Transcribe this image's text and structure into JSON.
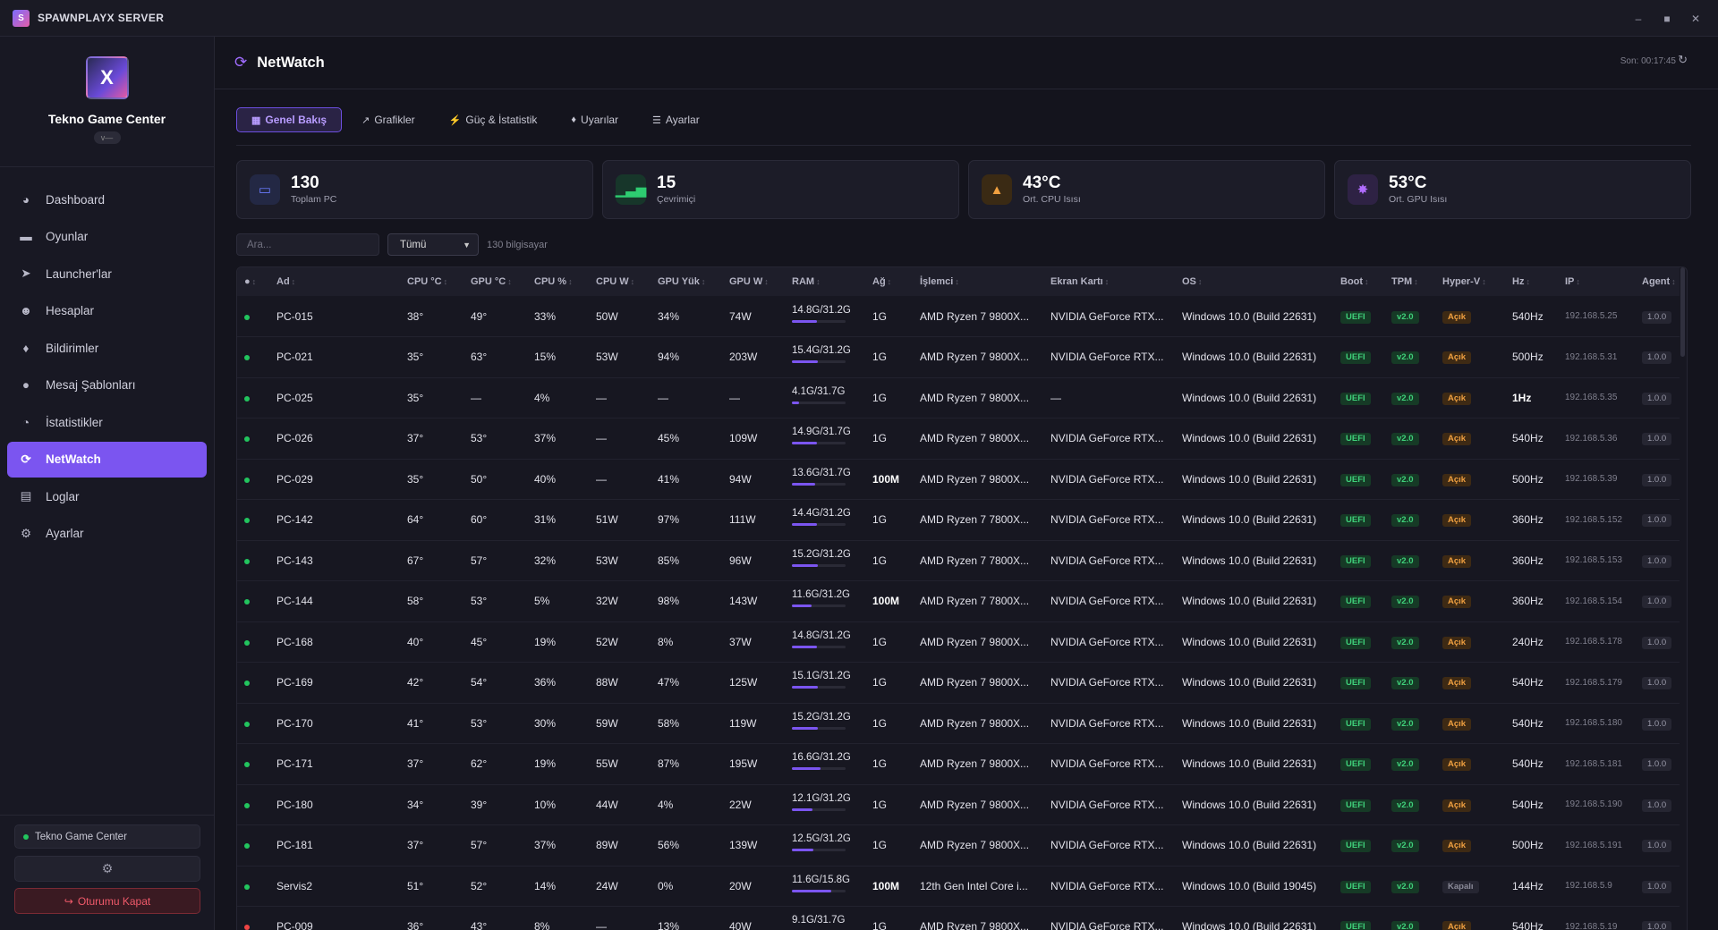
{
  "app": {
    "title": "SPAWNPLAYX SERVER",
    "icon_letter": "S"
  },
  "sidebar": {
    "logo_text": "X",
    "org_name": "Tekno Game Center",
    "org_badge": "v—",
    "items": [
      {
        "label": "Dashboard",
        "icon": "dashboard-icon"
      },
      {
        "label": "Oyunlar",
        "icon": "gamepad-icon"
      },
      {
        "label": "Launcher'lar",
        "icon": "rocket-icon"
      },
      {
        "label": "Hesaplar",
        "icon": "users-icon"
      },
      {
        "label": "Bildirimler",
        "icon": "bell-icon"
      },
      {
        "label": "Mesaj Şablonları",
        "icon": "comments-icon"
      },
      {
        "label": "İstatistikler",
        "icon": "pie-chart-icon"
      },
      {
        "label": "NetWatch",
        "icon": "netwatch-icon",
        "active": true
      },
      {
        "label": "Loglar",
        "icon": "clipboard-icon"
      },
      {
        "label": "Ayarlar",
        "icon": "gear-icon"
      }
    ],
    "center_name": "Tekno Game Center",
    "logout_label": "Oturumu Kapat"
  },
  "header": {
    "title": "NetWatch",
    "last_update": "Son: 00:17:45"
  },
  "tabs": [
    {
      "label": "Genel Bakış",
      "icon": "table-icon",
      "active": true
    },
    {
      "label": "Grafikler",
      "icon": "chart-icon"
    },
    {
      "label": "Güç & İstatistik",
      "icon": "bolt-icon"
    },
    {
      "label": "Uyarılar",
      "icon": "bell-icon"
    },
    {
      "label": "Ayarlar",
      "icon": "sliders-icon"
    }
  ],
  "stats": [
    {
      "value": "130",
      "label": "Toplam PC",
      "icon": "monitor-icon",
      "color": "#6a7cff",
      "bg": "#232844"
    },
    {
      "value": "15",
      "label": "Çevrimiçi",
      "icon": "signal-icon",
      "color": "#2ecc71",
      "bg": "#17362a"
    },
    {
      "value": "43°C",
      "label": "Ort. CPU Isısı",
      "icon": "thermometer-icon",
      "color": "#f0a040",
      "bg": "#3a2a14"
    },
    {
      "value": "53°C",
      "label": "Ort. GPU Isısı",
      "icon": "gpu-icon",
      "color": "#b06cff",
      "bg": "#2e2244"
    }
  ],
  "filters": {
    "search_placeholder": "Ara...",
    "select_value": "Tümü",
    "count_label": "130 bilgisayar"
  },
  "table": {
    "columns": [
      "●",
      "Ad",
      "CPU °C",
      "GPU °C",
      "CPU %",
      "CPU W",
      "GPU Yük",
      "GPU W",
      "RAM",
      "Ağ",
      "İşlemci",
      "Ekran Kartı",
      "OS",
      "Boot",
      "TPM",
      "Hyper-V",
      "Hz",
      "IP",
      "Agent"
    ],
    "rows": [
      {
        "status": "online",
        "name": "PC-015",
        "cpu_t": "38°",
        "gpu_t": "49°",
        "cpu_p": "33%",
        "cpu_w": "50W",
        "gpu_l": "34%",
        "gpu_w": "74W",
        "ram": "14.8G/31.2G",
        "ram_frac": 0.47,
        "net": "1G",
        "cpu": "AMD Ryzen 7 9800X...",
        "gpu": "NVIDIA GeForce RTX...",
        "os": "Windows 10.0 (Build 22631)",
        "boot": "UEFI",
        "tpm": "v2.0",
        "hv": "Açık",
        "hz": "540Hz",
        "ip": "192.168.5.25",
        "agent": "1.0.0"
      },
      {
        "status": "online",
        "name": "PC-021",
        "cpu_t": "35°",
        "gpu_t": "63°",
        "cpu_p": "15%",
        "cpu_w": "53W",
        "gpu_l": "94%",
        "gpu_w": "203W",
        "ram": "15.4G/31.2G",
        "ram_frac": 0.49,
        "net": "1G",
        "cpu": "AMD Ryzen 7 9800X...",
        "gpu": "NVIDIA GeForce RTX...",
        "os": "Windows 10.0 (Build 22631)",
        "boot": "UEFI",
        "tpm": "v2.0",
        "hv": "Açık",
        "hz": "500Hz",
        "ip": "192.168.5.31",
        "agent": "1.0.0"
      },
      {
        "status": "online",
        "name": "PC-025",
        "cpu_t": "35°",
        "gpu_t": "—",
        "cpu_p": "4%",
        "cpu_w": "—",
        "gpu_l": "—",
        "gpu_w": "—",
        "ram": "4.1G/31.7G",
        "ram_frac": 0.13,
        "net": "1G",
        "cpu": "AMD Ryzen 7 9800X...",
        "gpu": "—",
        "os": "Windows 10.0 (Build 22631)",
        "boot": "UEFI",
        "tpm": "v2.0",
        "hv": "Açık",
        "hz": "1Hz",
        "hz_bold": true,
        "ip": "192.168.5.35",
        "agent": "1.0.0"
      },
      {
        "status": "online",
        "name": "PC-026",
        "cpu_t": "37°",
        "gpu_t": "53°",
        "cpu_p": "37%",
        "cpu_w": "—",
        "gpu_l": "45%",
        "gpu_w": "109W",
        "ram": "14.9G/31.7G",
        "ram_frac": 0.47,
        "net": "1G",
        "cpu": "AMD Ryzen 7 9800X...",
        "gpu": "NVIDIA GeForce RTX...",
        "os": "Windows 10.0 (Build 22631)",
        "boot": "UEFI",
        "tpm": "v2.0",
        "hv": "Açık",
        "hz": "540Hz",
        "ip": "192.168.5.36",
        "agent": "1.0.0"
      },
      {
        "status": "online",
        "name": "PC-029",
        "cpu_t": "35°",
        "gpu_t": "50°",
        "cpu_p": "40%",
        "cpu_w": "—",
        "gpu_l": "41%",
        "gpu_w": "94W",
        "ram": "13.6G/31.7G",
        "ram_frac": 0.43,
        "net": "100M",
        "net_bold": true,
        "cpu": "AMD Ryzen 7 9800X...",
        "gpu": "NVIDIA GeForce RTX...",
        "os": "Windows 10.0 (Build 22631)",
        "boot": "UEFI",
        "tpm": "v2.0",
        "hv": "Açık",
        "hz": "500Hz",
        "ip": "192.168.5.39",
        "agent": "1.0.0"
      },
      {
        "status": "online",
        "name": "PC-142",
        "cpu_t": "64°",
        "gpu_t": "60°",
        "cpu_p": "31%",
        "cpu_w": "51W",
        "gpu_l": "97%",
        "gpu_w": "111W",
        "ram": "14.4G/31.2G",
        "ram_frac": 0.46,
        "net": "1G",
        "cpu": "AMD Ryzen 7 7800X...",
        "gpu": "NVIDIA GeForce RTX...",
        "os": "Windows 10.0 (Build 22631)",
        "boot": "UEFI",
        "tpm": "v2.0",
        "hv": "Açık",
        "hz": "360Hz",
        "ip": "192.168.5.152",
        "agent": "1.0.0"
      },
      {
        "status": "online",
        "name": "PC-143",
        "cpu_t": "67°",
        "gpu_t": "57°",
        "cpu_p": "32%",
        "cpu_w": "53W",
        "gpu_l": "85%",
        "gpu_w": "96W",
        "ram": "15.2G/31.2G",
        "ram_frac": 0.49,
        "net": "1G",
        "cpu": "AMD Ryzen 7 7800X...",
        "gpu": "NVIDIA GeForce RTX...",
        "os": "Windows 10.0 (Build 22631)",
        "boot": "UEFI",
        "tpm": "v2.0",
        "hv": "Açık",
        "hz": "360Hz",
        "ip": "192.168.5.153",
        "agent": "1.0.0"
      },
      {
        "status": "online",
        "name": "PC-144",
        "cpu_t": "58°",
        "gpu_t": "53°",
        "cpu_p": "5%",
        "cpu_w": "32W",
        "gpu_l": "98%",
        "gpu_w": "143W",
        "ram": "11.6G/31.2G",
        "ram_frac": 0.37,
        "net": "100M",
        "net_bold": true,
        "cpu": "AMD Ryzen 7 7800X...",
        "gpu": "NVIDIA GeForce RTX...",
        "os": "Windows 10.0 (Build 22631)",
        "boot": "UEFI",
        "tpm": "v2.0",
        "hv": "Açık",
        "hz": "360Hz",
        "ip": "192.168.5.154",
        "agent": "1.0.0"
      },
      {
        "status": "online",
        "name": "PC-168",
        "cpu_t": "40°",
        "gpu_t": "45°",
        "cpu_p": "19%",
        "cpu_w": "52W",
        "gpu_l": "8%",
        "gpu_w": "37W",
        "ram": "14.8G/31.2G",
        "ram_frac": 0.47,
        "net": "1G",
        "cpu": "AMD Ryzen 7 9800X...",
        "gpu": "NVIDIA GeForce RTX...",
        "os": "Windows 10.0 (Build 22631)",
        "boot": "UEFI",
        "tpm": "v2.0",
        "hv": "Açık",
        "hz": "240Hz",
        "ip": "192.168.5.178",
        "agent": "1.0.0"
      },
      {
        "status": "online",
        "name": "PC-169",
        "cpu_t": "42°",
        "gpu_t": "54°",
        "cpu_p": "36%",
        "cpu_w": "88W",
        "gpu_l": "47%",
        "gpu_w": "125W",
        "ram": "15.1G/31.2G",
        "ram_frac": 0.48,
        "net": "1G",
        "cpu": "AMD Ryzen 7 9800X...",
        "gpu": "NVIDIA GeForce RTX...",
        "os": "Windows 10.0 (Build 22631)",
        "boot": "UEFI",
        "tpm": "v2.0",
        "hv": "Açık",
        "hz": "540Hz",
        "ip": "192.168.5.179",
        "agent": "1.0.0"
      },
      {
        "status": "online",
        "name": "PC-170",
        "cpu_t": "41°",
        "gpu_t": "53°",
        "cpu_p": "30%",
        "cpu_w": "59W",
        "gpu_l": "58%",
        "gpu_w": "119W",
        "ram": "15.2G/31.2G",
        "ram_frac": 0.49,
        "net": "1G",
        "cpu": "AMD Ryzen 7 9800X...",
        "gpu": "NVIDIA GeForce RTX...",
        "os": "Windows 10.0 (Build 22631)",
        "boot": "UEFI",
        "tpm": "v2.0",
        "hv": "Açık",
        "hz": "540Hz",
        "ip": "192.168.5.180",
        "agent": "1.0.0"
      },
      {
        "status": "online",
        "name": "PC-171",
        "cpu_t": "37°",
        "gpu_t": "62°",
        "cpu_p": "19%",
        "cpu_w": "55W",
        "gpu_l": "87%",
        "gpu_w": "195W",
        "ram": "16.6G/31.2G",
        "ram_frac": 0.53,
        "net": "1G",
        "cpu": "AMD Ryzen 7 9800X...",
        "gpu": "NVIDIA GeForce RTX...",
        "os": "Windows 10.0 (Build 22631)",
        "boot": "UEFI",
        "tpm": "v2.0",
        "hv": "Açık",
        "hz": "540Hz",
        "ip": "192.168.5.181",
        "agent": "1.0.0"
      },
      {
        "status": "online",
        "name": "PC-180",
        "cpu_t": "34°",
        "gpu_t": "39°",
        "cpu_p": "10%",
        "cpu_w": "44W",
        "gpu_l": "4%",
        "gpu_w": "22W",
        "ram": "12.1G/31.2G",
        "ram_frac": 0.39,
        "net": "1G",
        "cpu": "AMD Ryzen 7 9800X...",
        "gpu": "NVIDIA GeForce RTX...",
        "os": "Windows 10.0 (Build 22631)",
        "boot": "UEFI",
        "tpm": "v2.0",
        "hv": "Açık",
        "hz": "540Hz",
        "ip": "192.168.5.190",
        "agent": "1.0.0"
      },
      {
        "status": "online",
        "name": "PC-181",
        "cpu_t": "37°",
        "gpu_t": "57°",
        "cpu_p": "37%",
        "cpu_w": "89W",
        "gpu_l": "56%",
        "gpu_w": "139W",
        "ram": "12.5G/31.2G",
        "ram_frac": 0.4,
        "net": "1G",
        "cpu": "AMD Ryzen 7 9800X...",
        "gpu": "NVIDIA GeForce RTX...",
        "os": "Windows 10.0 (Build 22631)",
        "boot": "UEFI",
        "tpm": "v2.0",
        "hv": "Açık",
        "hz": "500Hz",
        "ip": "192.168.5.191",
        "agent": "1.0.0"
      },
      {
        "status": "online",
        "name": "Servis2",
        "cpu_t": "51°",
        "gpu_t": "52°",
        "cpu_p": "14%",
        "cpu_w": "24W",
        "gpu_l": "0%",
        "gpu_w": "20W",
        "ram": "11.6G/15.8G",
        "ram_frac": 0.73,
        "net": "100M",
        "net_bold": true,
        "cpu": "12th Gen Intel Core i...",
        "gpu": "NVIDIA GeForce RTX...",
        "os": "Windows 10.0 (Build 19045)",
        "boot": "UEFI",
        "tpm": "v2.0",
        "hv": "Kapalı",
        "hz": "144Hz",
        "ip": "192.168.5.9",
        "agent": "1.0.0"
      },
      {
        "status": "offline",
        "name": "PC-009",
        "cpu_t": "36°",
        "gpu_t": "43°",
        "cpu_p": "8%",
        "cpu_w": "—",
        "gpu_l": "13%",
        "gpu_w": "40W",
        "ram": "9.1G/31.7G",
        "ram_frac": 0.29,
        "net": "1G",
        "cpu": "AMD Ryzen 7 9800X...",
        "gpu": "NVIDIA GeForce RTX...",
        "os": "Windows 10.0 (Build 22631)",
        "boot": "UEFI",
        "tpm": "v2.0",
        "hv": "Açık",
        "hz": "540Hz",
        "ip": "192.168.5.19",
        "agent": "1.0.0"
      }
    ]
  },
  "colors": {
    "accent": "#7b55f0",
    "online": "#22c55e",
    "offline": "#ef4444"
  }
}
